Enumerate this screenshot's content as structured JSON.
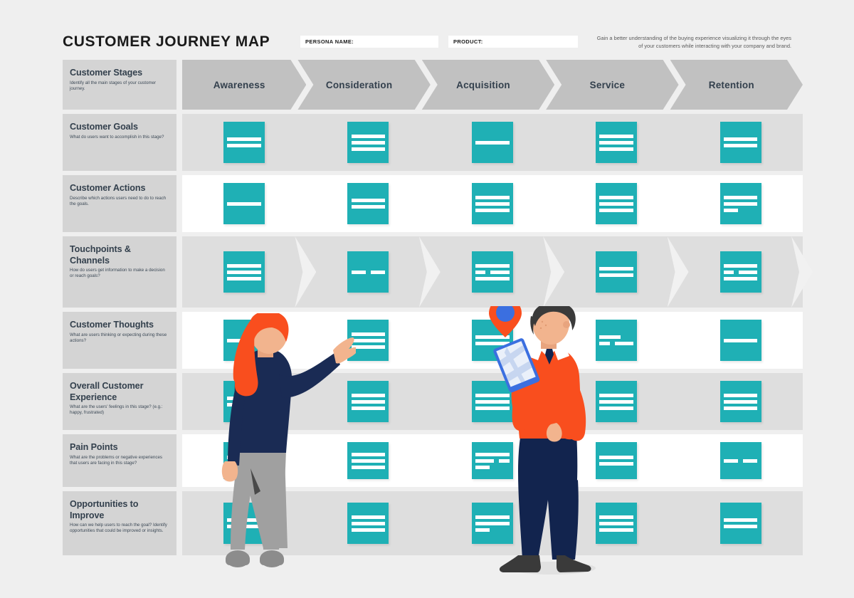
{
  "header": {
    "title": "CUSTOMER JOURNEY MAP",
    "persona_label": "PERSONA NAME:",
    "persona_value": "",
    "product_label": "PRODUCT:",
    "product_value": "",
    "description": "Gain a better understanding of the buying experience visualizing it through the eyes of your customers while interacting with your company and brand."
  },
  "colors": {
    "teal": "#1FB0B5",
    "orange": "#F94E1E",
    "navy": "#1A2B54",
    "chevron_gray": "#C1C1C1",
    "label_gray": "#D4D4D4",
    "row_shaded": "#DEDEDE",
    "canvas": "#EFEFEF",
    "heading_text": "#33404D"
  },
  "stages": [
    {
      "label": "Awareness"
    },
    {
      "label": "Consideration"
    },
    {
      "label": "Acquisition"
    },
    {
      "label": "Service"
    },
    {
      "label": "Retention"
    }
  ],
  "rows": [
    {
      "title": "Customer Stages",
      "subtitle": "Identify all the main stages of your customer journey."
    },
    {
      "title": "Customer Goals",
      "subtitle": "What do users want to accomplish in this stage?"
    },
    {
      "title": "Customer Actions",
      "subtitle": "Describe which actions users need to do to reach the goals."
    },
    {
      "title": "Touchpoints & Channels",
      "subtitle": "How do users get information to make a decision or reach goals?"
    },
    {
      "title": "Customer Thoughts",
      "subtitle": "What are users thinking or expecting during these actions?"
    },
    {
      "title": "Overall Customer Experience",
      "subtitle": "What are the users' feelings in this stage? (e.g.: happy, frustrated)"
    },
    {
      "title": "Pain Points",
      "subtitle": "What are the problems or negative experiences that users are facing in this stage?"
    },
    {
      "title": "Opportunities to Improve",
      "subtitle": "How can we help users to reach the goal? Identify opportunities that could be improved or insights."
    }
  ],
  "notes": {
    "customer_goals": [
      "2-lines",
      "3-lines",
      "1-line",
      "3-lines",
      "2-lines"
    ],
    "customer_actions": [
      "1-line",
      "2-lines",
      "3-lines",
      "3-lines",
      "2-lines-plus-short"
    ],
    "touchpoints": [
      "3-lines",
      "2-short-split",
      "line-split-line",
      "2-lines",
      "line-split-line"
    ],
    "customer_thoughts": [
      "1-line",
      "3-lines",
      "2-lines",
      "line-split",
      "1-line"
    ],
    "overall_experience": [
      "split-split",
      "3-lines",
      "3-lines",
      "3-lines",
      "3-lines"
    ],
    "pain_points": [
      "2-lines",
      "3-lines",
      "line-split-short",
      "2-lines",
      "2-short-split"
    ],
    "opportunities": [
      "2-lines",
      "3-lines",
      "2-lines-plus-short",
      "3-lines",
      "2-lines"
    ]
  },
  "illustration": {
    "woman": {
      "name": "woman-pointing-at-board",
      "hair": "#F94E1E",
      "top": "#1A2B54",
      "pants": "#A0A0A0",
      "shoes": "#8C8C8C",
      "skin": "#F2B48E"
    },
    "man": {
      "name": "man-holding-phone",
      "hair": "#3A3A3A",
      "sweater": "#F94E1E",
      "pants": "#12244E",
      "shoes": "#3A3A3A",
      "skin": "#F2B48E"
    },
    "map_pin": {
      "name": "map-location-pin",
      "outer": "#F94E1E",
      "inner": "#3B6FE0"
    },
    "phone": {
      "name": "phone-with-map",
      "body": "#3B6FE0",
      "screen": "#EAF0FA"
    }
  }
}
